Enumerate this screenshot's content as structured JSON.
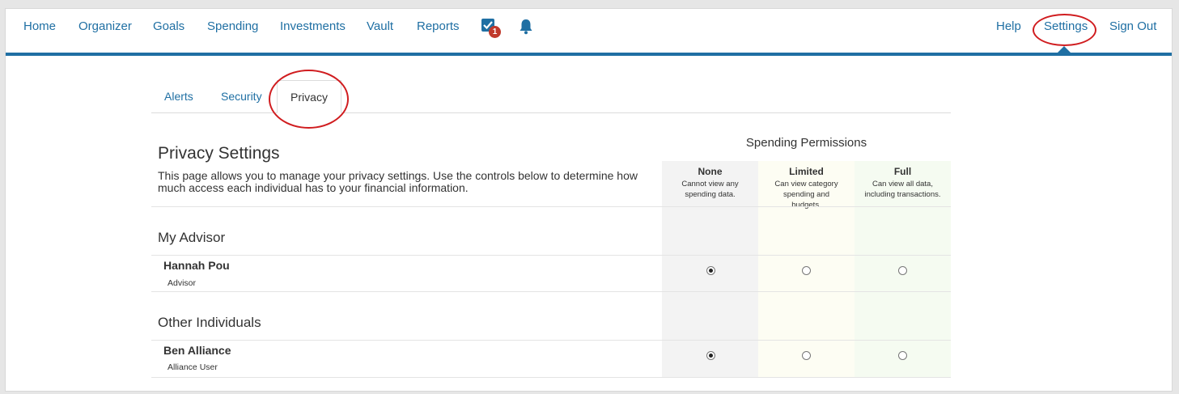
{
  "nav": {
    "home": "Home",
    "organizer": "Organizer",
    "goals": "Goals",
    "spending": "Spending",
    "investments": "Investments",
    "vault": "Vault",
    "reports": "Reports",
    "tasks_badge": "1",
    "help": "Help",
    "settings": "Settings",
    "sign_out": "Sign Out"
  },
  "tabs": {
    "alerts": "Alerts",
    "security": "Security",
    "privacy": "Privacy"
  },
  "page": {
    "title": "Privacy Settings",
    "description": "This page allows you to manage your privacy settings.  Use the controls below to determine how much access each individual has to your financial information."
  },
  "permissions": {
    "title": "Spending Permissions",
    "columns": [
      {
        "title": "None",
        "desc": "Cannot view any spending data."
      },
      {
        "title": "Limited",
        "desc": "Can view category spending and budgets."
      },
      {
        "title": "Full",
        "desc": "Can view all data, including transactions."
      }
    ]
  },
  "sections": [
    {
      "title": "My Advisor",
      "person": {
        "name": "Hannah Pou",
        "role": "Advisor",
        "permission": "None"
      }
    },
    {
      "title": "Other Individuals",
      "person": {
        "name": "Ben Alliance",
        "role": "Alliance User",
        "permission": "None"
      }
    }
  ],
  "colors": {
    "accent": "#1f6fa3",
    "highlight_oval": "#d01c1f",
    "badge": "#c0392b"
  }
}
